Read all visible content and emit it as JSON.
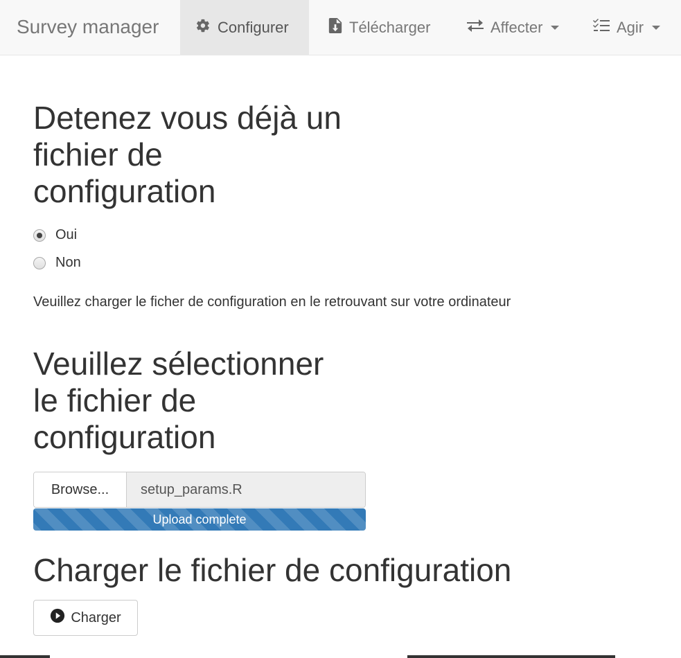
{
  "navbar": {
    "brand": "Survey manager",
    "items": [
      {
        "label": "Configurer",
        "icon": "gear-icon",
        "active": true
      },
      {
        "label": "Télécharger",
        "icon": "file-download-icon"
      },
      {
        "label": "Affecter",
        "icon": "exchange-icon",
        "dropdown": true
      },
      {
        "label": "Agir",
        "icon": "tasks-icon",
        "dropdown": true
      }
    ]
  },
  "section1": {
    "heading_lines": [
      "Detenez vous déjà un",
      "fichier de",
      "configuration"
    ],
    "radios": [
      {
        "label": "Oui",
        "checked": true
      },
      {
        "label": "Non",
        "checked": false
      }
    ],
    "help_text": "Veuillez charger le ficher de configuration en le retrouvant sur votre ordinateur"
  },
  "section2": {
    "heading_lines": [
      "Veuillez sélectionner",
      "le fichier de",
      "configuration"
    ],
    "browse_label": "Browse...",
    "file_name": "setup_params.R",
    "progress_label": "Upload complete",
    "progress_percent": 100
  },
  "section3": {
    "heading": "Charger le fichier de configuration",
    "button_label": "Charger",
    "button_icon": "play-circle-icon"
  },
  "colors": {
    "navbar_bg": "#f8f8f8",
    "active_tab_bg": "#e7e7e7",
    "progress": "#337ab7"
  }
}
